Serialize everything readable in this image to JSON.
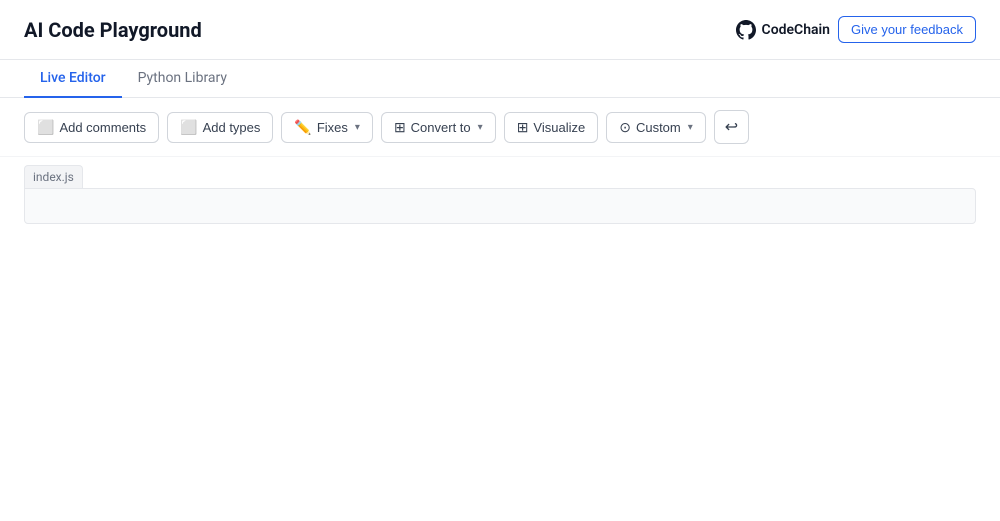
{
  "header": {
    "title": "AI Code Playground",
    "brand": {
      "name": "CodeChain"
    }
  },
  "feedback": {
    "label": "Give your feedback"
  },
  "tabs": [
    {
      "label": "Live Editor",
      "active": true
    },
    {
      "label": "Python Library",
      "active": false
    }
  ],
  "toolbar": {
    "add_comments_label": "Add comments",
    "add_types_label": "Add types",
    "fixes_label": "Fixes",
    "convert_to_label": "Convert to",
    "visualize_label": "Visualize",
    "custom_label": "Custom"
  },
  "editor": {
    "file_name": "index.js"
  }
}
